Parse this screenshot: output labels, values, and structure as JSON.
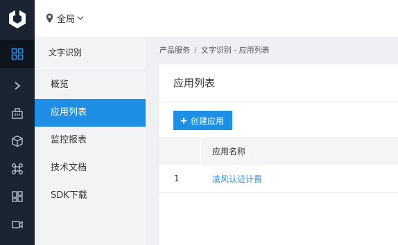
{
  "topbar": {
    "scope_label": "全局"
  },
  "rail": {
    "tooltip": "总览"
  },
  "sidebar": {
    "title": "文字识别",
    "items": [
      {
        "label": "概览"
      },
      {
        "label": "应用列表"
      },
      {
        "label": "监控报表"
      },
      {
        "label": "技术文档"
      },
      {
        "label": "SDK下载"
      }
    ]
  },
  "breadcrumb": {
    "root": "产品服务",
    "separator": "/",
    "current": "文字识别 - 应用列表"
  },
  "main": {
    "title": "应用列表",
    "create_button": "创建应用",
    "table": {
      "columns": [
        "",
        "应用名称"
      ],
      "rows": [
        {
          "index": "1",
          "name": "凌风认证计费"
        }
      ]
    }
  },
  "colors": {
    "rail_bg": "#1b2432",
    "accent": "#1f8fe5",
    "sidebar_bg": "#f2f3f5",
    "main_bg": "#eef0f3"
  }
}
